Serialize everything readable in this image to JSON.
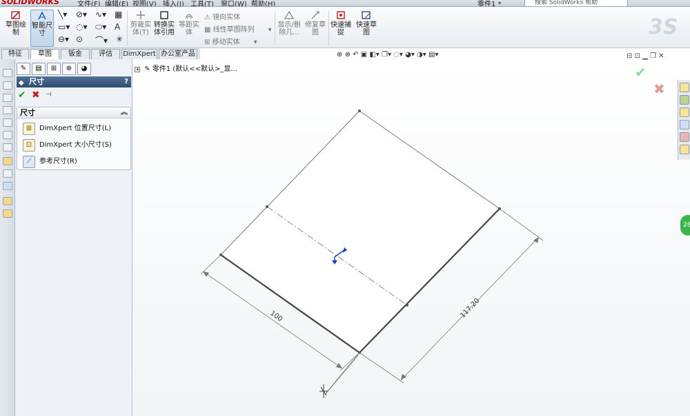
{
  "titlebar": {
    "logo": "SOLIDWORKS",
    "menus": [
      "文件(F)",
      "编辑(E)",
      "视图(V)",
      "插入(I)",
      "工具(T)",
      "窗口(W)",
      "帮助(H)"
    ],
    "document_title": "零件1 *",
    "help_search_placeholder": "搜索 SolidWorks 帮助"
  },
  "commands": {
    "sketch_label": "草图绘制",
    "smart_dim_label": "智能尺寸",
    "trim_label": "剪裁实体(T)",
    "convert_label": "转换实体引用",
    "offset_label": "等距实体",
    "mirror_label": "镜向实体",
    "linear_pattern_label": "线性草图阵列",
    "move_label": "移动实体",
    "display_delete_label": "显示/删除几...",
    "repair_label": "修复草图",
    "quick_snaps_label": "快速捕捉",
    "rapid_sketch_label": "快速草图"
  },
  "tabs": [
    "特征",
    "草图",
    "钣金",
    "评估",
    "DimXpert",
    "办公室产品"
  ],
  "active_tab": "草图",
  "property_manager": {
    "title": "尺寸",
    "help": "?",
    "group_title": "尺寸",
    "items": [
      {
        "label": "DimXpert 位置尺寸(L)",
        "icon": "location-dim-icon"
      },
      {
        "label": "DimXpert 大小尺寸(S)",
        "icon": "size-dim-icon"
      },
      {
        "label": "参考尺寸(R)",
        "icon": "reference-dim-icon"
      }
    ]
  },
  "feature_tree": {
    "root": "零件1 (默认<<默认>_显..."
  },
  "drawing": {
    "dimension_a": "100",
    "dimension_b": "117.20",
    "rebuild_badge": "28"
  },
  "colors": {
    "ok_green": "#2a9a2a",
    "cancel_red": "#c21d1d",
    "header_blue": "#3a5a80",
    "badge_green": "#3cb44a"
  }
}
